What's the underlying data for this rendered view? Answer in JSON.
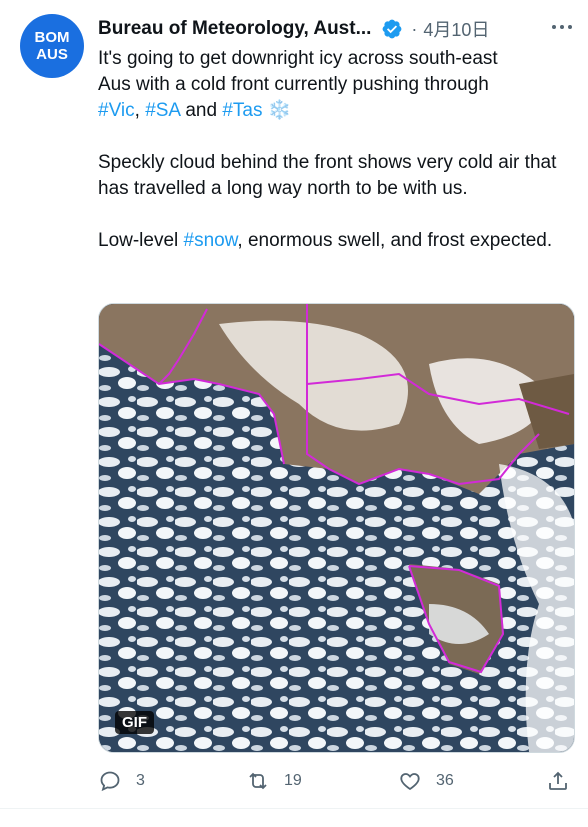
{
  "account": {
    "avatar_line1": "BOM",
    "avatar_line2": "AUS",
    "display_name": "Bureau of Meteorology, Aust...",
    "date": "4月10日"
  },
  "tweet": {
    "line1": "It's going to get downright icy across south-east",
    "line2_prefix": "Aus with a cold front currently pushing through",
    "hashtag_vic": "#Vic",
    "comma": ",",
    "hashtag_sa": "#SA",
    "and": "and",
    "hashtag_tas": "#Tas",
    "emoji": "❄️",
    "para2": "Speckly cloud behind the front shows very cold air that has travelled a long way north to be with us.",
    "para3_prefix": "Low-level",
    "hashtag_snow": "#snow",
    "para3_suffix": ", enormous swell, and frost expected."
  },
  "media": {
    "badge": "GIF",
    "description_icon": "satellite-image"
  },
  "actions": {
    "replies": "3",
    "retweets": "19",
    "likes": "36"
  },
  "colors": {
    "accent": "#1d9bf0",
    "avatar_bg": "#1a6fe0",
    "muted": "#536471",
    "border_overlay": "#d22ad8"
  }
}
